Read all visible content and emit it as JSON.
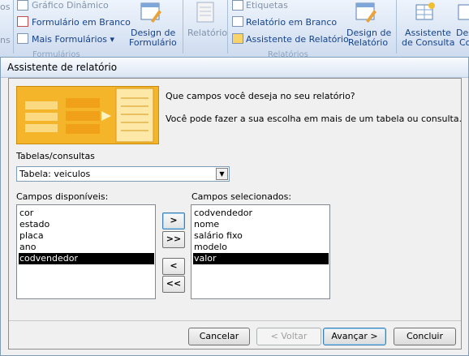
{
  "ribbon": {
    "group1": {
      "partial_left": "os",
      "partial_left2": "ns",
      "items": [
        "Gráfico Dinâmico",
        "Formulário em Branco",
        "Mais Formulários ▾"
      ],
      "big_button": [
        "Design de",
        "Formulário"
      ],
      "group_label": "Formulários"
    },
    "group2": {
      "small_left": "Relatório",
      "items": [
        "Etiquetas",
        "Relatório em Branco",
        "Assistente de Relatório"
      ],
      "big_button": [
        "Design de",
        "Relatório"
      ],
      "group_label": "Relatórios"
    },
    "group3": {
      "big_button": [
        "Assistente",
        "de Consulta"
      ],
      "partial_right": [
        "Des",
        "Co"
      ]
    }
  },
  "dialog": {
    "title": "Assistente de relatório",
    "question": "Que campos você deseja no seu relatório?",
    "hint": "Você pode fazer a sua escolha em mais de um tabela ou consulta.",
    "tables_label": "Tabelas/consultas",
    "table_selected": "Tabela: veiculos",
    "available_label": "Campos disponíveis:",
    "available_fields": [
      "cor",
      "estado",
      "placa",
      "ano",
      "codvendedor"
    ],
    "available_selected_index": 4,
    "selected_label": "Campos selecionados:",
    "selected_fields": [
      "codvendedor",
      "nome",
      "salário fixo",
      "modelo",
      "valor"
    ],
    "selected_selected_index": 4,
    "move_buttons": [
      ">",
      ">>",
      "<",
      "<<"
    ],
    "buttons": {
      "cancel": "Cancelar",
      "back": "< Voltar",
      "next": "Avançar >",
      "finish": "Concluir"
    }
  },
  "colors": {
    "ribbon_text": "#15428b",
    "banner": "#f4b221",
    "selection": "#000000"
  }
}
